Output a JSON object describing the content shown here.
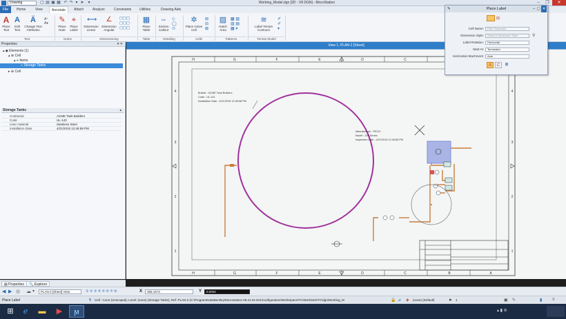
{
  "title_bar": {
    "workflow": "Drawing",
    "title": "Working_Model.dgn [2D - V8 DGN] - MicroStation",
    "minimize": "–",
    "maximize": "❐",
    "close": "✕"
  },
  "menu": {
    "file": "File",
    "tabs": [
      "Home",
      "View",
      "Annotate",
      "Attach",
      "Analyze",
      "Constraints",
      "Utilities",
      "Drawing Aids"
    ],
    "active_tab": "Annotate"
  },
  "ribbon": {
    "groups": {
      "text": {
        "label": "Text",
        "buttons": [
          "Place Text",
          "Edit Text",
          "Change Text Attributes"
        ]
      },
      "notes": {
        "label": "Notes",
        "buttons": [
          "Place Note",
          "Place Label"
        ]
      },
      "dimensioning": {
        "label": "Dimensioning",
        "buttons": [
          "Dimension Linear",
          "Dimension Angular"
        ]
      },
      "table": {
        "label": "Table",
        "buttons": [
          "Place Table"
        ]
      },
      "detailing": {
        "label": "Detailing",
        "buttons": [
          "Section Callout"
        ]
      },
      "cells": {
        "label": "Cells",
        "buttons": [
          "Place Active Cell"
        ]
      },
      "patterns": {
        "label": "Patterns",
        "buttons": [
          "Hatch Area"
        ]
      },
      "terrain": {
        "label": "Terrain Model",
        "buttons": [
          "Label Terrain Contours"
        ]
      }
    }
  },
  "properties_panel": {
    "header": "Properties",
    "tree": [
      {
        "label": "Elements (1)",
        "level": 0
      },
      {
        "label": "Cell",
        "level": 1
      },
      {
        "label": "Items",
        "level": 2
      },
      {
        "label": "Storage Tanks",
        "level": 3,
        "selected": true
      },
      {
        "label": "Cell",
        "level": 1
      }
    ],
    "section_title": "Storage Tanks",
    "properties": [
      {
        "key": "Contractor",
        "value": "ACME Tank Builders"
      },
      {
        "key": "Code",
        "value": "UL-143"
      },
      {
        "key": "Liner material",
        "value": "Stainless Steel"
      },
      {
        "key": "Installation Date",
        "value": "4/21/2015 12:45:58 PM"
      }
    ],
    "tabs": [
      "Properties",
      "Explorer"
    ]
  },
  "view": {
    "title": "View 1, PLAN-2 [Sheet]",
    "col_labels": [
      "H",
      "G",
      "F",
      "E",
      "D",
      "C",
      "B",
      "A"
    ],
    "row_labels": [
      "4",
      "3",
      "2",
      "1"
    ],
    "annotation_tank": {
      "line1": "Builder : ACME Tank Builders",
      "line2": "Code : UL-141",
      "line3": "Installation Date : 4/21/2015 12:45:58 PM"
    },
    "annotation_pump": {
      "line1": "Manufacturer : PECO",
      "line2": "Model : 200 Series",
      "line3": "Inspection Date : 4/21/2015 12:45:58 PM"
    }
  },
  "place_label": {
    "title": "Place Label",
    "fields": [
      {
        "label": "Cell Name:",
        "value": "Filter Separator",
        "dim": true
      },
      {
        "label": "Dimension Style:",
        "value": "Select a Dimension Style",
        "dim": true
      },
      {
        "label": "Label Rotation:",
        "value": "Horizontal",
        "dim": false
      },
      {
        "label": "Start At:",
        "value": "Terminator",
        "dim": false
      },
      {
        "label": "Horizontal Attachment:",
        "value": "Auto",
        "dim": false
      }
    ]
  },
  "coordinates": {
    "x_label": "X",
    "x_value": "368.1673",
    "y_label": "Y",
    "y_value": "0.0002",
    "view_selector": "PLAN-2 [Sheet] View"
  },
  "status": {
    "tool": "Place Label",
    "message": "Cell : Cone (Unscoped), Level: (none) (Storage Tanks), Ref: PLAN-2 (C:\\ProgramData\\Bentley\\MicroStation 08.21.04.041\\Configuration\\WorkSpace\\TC\\WorkSets\\TC\\dgn\\Working_M",
    "level": "(none) (Default)",
    "scale": "1"
  },
  "colors": {
    "accent": "#2b6cb5",
    "view_title": "#2e7ec9",
    "tank": "#a0309c",
    "pipe": "#c87d3a",
    "selection": "#6a7fd6"
  }
}
